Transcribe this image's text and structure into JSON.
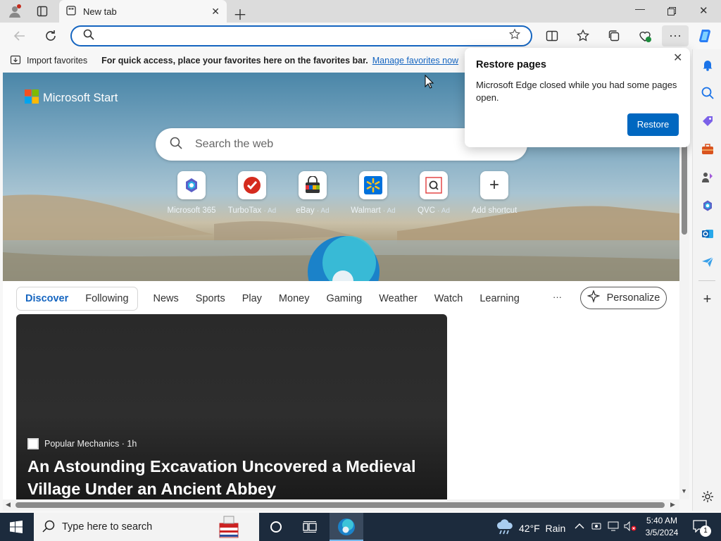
{
  "tab": {
    "title": "New tab"
  },
  "omnibox": {
    "placeholder": ""
  },
  "favorites_bar": {
    "import_label": "Import favorites",
    "message": "For quick access, place your favorites here on the favorites bar.",
    "manage_link": "Manage favorites now"
  },
  "start": {
    "brand": "Microsoft Start",
    "search_placeholder": "Search the web",
    "quick_links": [
      {
        "label": "Microsoft 365",
        "ad": ""
      },
      {
        "label": "TurboTax",
        "ad": "· Ad"
      },
      {
        "label": "eBay",
        "ad": "· Ad"
      },
      {
        "label": "Walmart",
        "ad": "· Ad"
      },
      {
        "label": "QVC",
        "ad": "· Ad"
      },
      {
        "label": "Add shortcut",
        "ad": ""
      }
    ]
  },
  "feed_nav": {
    "discover": "Discover",
    "following": "Following",
    "items": [
      "News",
      "Sports",
      "Play",
      "Money",
      "Gaming",
      "Weather",
      "Watch",
      "Learning"
    ],
    "more": "···",
    "personalize": "Personalize"
  },
  "article": {
    "source": "Popular Mechanics · 1h",
    "title": "An Astounding Excavation Uncovered a Medieval Village Under an Ancient Abbey"
  },
  "popup": {
    "title": "Restore pages",
    "message": "Microsoft Edge closed while you had some pages open.",
    "button": "Restore"
  },
  "taskbar": {
    "search_placeholder": "Type here to search",
    "weather": "42°F  Rain",
    "time": "5:40 AM",
    "date": "3/5/2024",
    "notification_count": "1"
  },
  "colors": {
    "accent": "#0067c0",
    "link": "#1565c0",
    "taskbar": "#1c2b3d"
  }
}
